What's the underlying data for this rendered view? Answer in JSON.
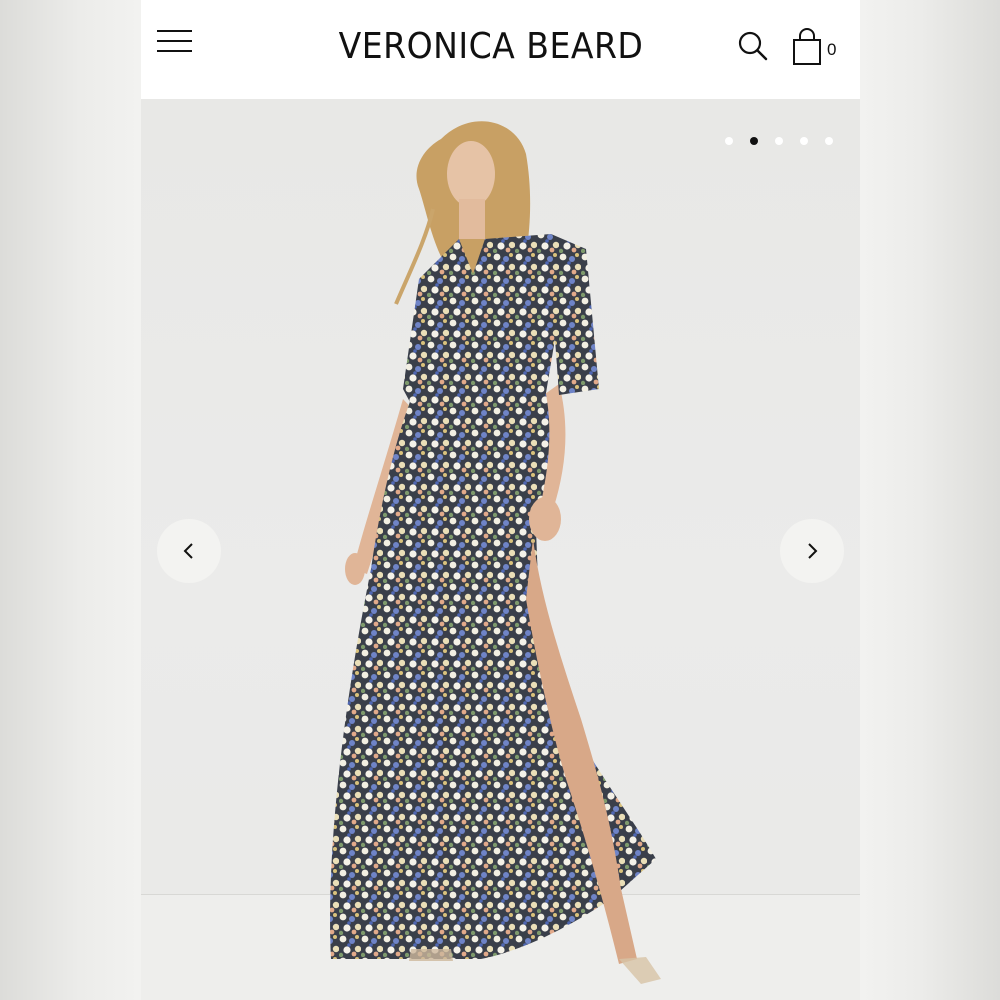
{
  "header": {
    "brand": "VERONICA BEARD",
    "cart_count": "0",
    "icons": [
      "hamburger-menu-icon",
      "search-icon",
      "shopping-bag-icon"
    ]
  },
  "carousel": {
    "slide_count": 5,
    "active_index": 1,
    "prev_icon": "chevron-left-icon",
    "next_icon": "chevron-right-icon"
  },
  "colors": {
    "header_bg": "#ffffff",
    "text": "#111111",
    "stage_bg": "#e9e9e7",
    "arrow_bg": "#f3f3f1"
  }
}
